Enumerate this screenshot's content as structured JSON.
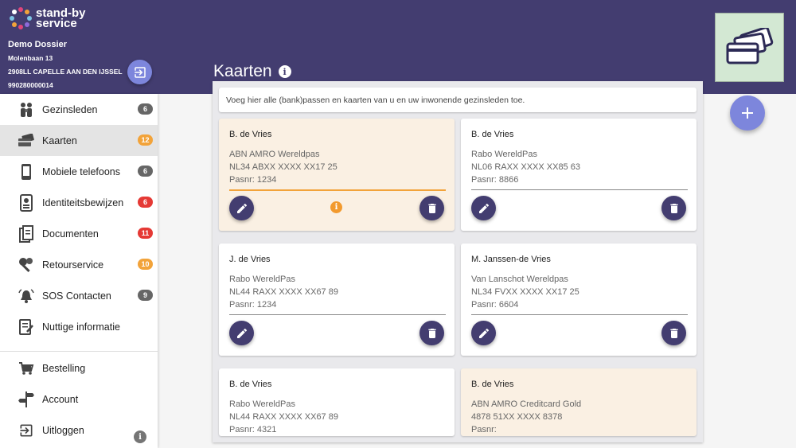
{
  "app": {
    "logo_line1": "stand-by",
    "logo_line2": "service"
  },
  "dossier": {
    "name": "Demo Dossier",
    "street": "Molenbaan 13",
    "city": "2908LL CAPELLE AAN DEN IJSSEL",
    "number": "990280000014"
  },
  "page": {
    "title": "Kaarten",
    "intro": "Voeg hier alle (bank)passen en kaarten van u en uw inwonende gezinsleden toe."
  },
  "sidebar": {
    "items": [
      {
        "label": "Gezinsleden",
        "badge": "6",
        "badge_color": "#666666",
        "icon": "family-icon"
      },
      {
        "label": "Kaarten",
        "badge": "12",
        "badge_color": "#f2a33a",
        "icon": "cards-icon",
        "active": true
      },
      {
        "label": "Mobiele telefoons",
        "badge": "6",
        "badge_color": "#666666",
        "icon": "phone-icon"
      },
      {
        "label": "Identiteitsbewijzen",
        "badge": "6",
        "badge_color": "#e53935",
        "icon": "id-card-icon"
      },
      {
        "label": "Documenten",
        "badge": "11",
        "badge_color": "#e53935",
        "icon": "documents-icon"
      },
      {
        "label": "Retourservice",
        "badge": "10",
        "badge_color": "#f2a33a",
        "icon": "keys-icon"
      },
      {
        "label": "SOS Contacten",
        "badge": "9",
        "badge_color": "#666666",
        "icon": "alarm-bell-icon"
      },
      {
        "label": "Nuttige informatie",
        "badge": "",
        "badge_color": "",
        "icon": "info-document-icon"
      }
    ],
    "bottom": [
      {
        "label": "Bestelling",
        "icon": "cart-icon"
      },
      {
        "label": "Account",
        "icon": "signpost-icon"
      },
      {
        "label": "Uitloggen",
        "icon": "logout-icon"
      }
    ]
  },
  "cards": [
    {
      "owner": "B. de Vries",
      "name": "ABN AMRO Wereldpas",
      "iban": "NL34 ABXX XXXX XX17 25",
      "pasnr": "Pasnr: 1234",
      "warning": true
    },
    {
      "owner": "B. de Vries",
      "name": "Rabo WereldPas",
      "iban": "NL06 RAXX XXXX XX85 63",
      "pasnr": "Pasnr: 8866",
      "warning": false
    },
    {
      "owner": "J. de Vries",
      "name": "Rabo WereldPas",
      "iban": "NL44 RAXX XXXX XX67 89",
      "pasnr": "Pasnr: 1234",
      "warning": false
    },
    {
      "owner": "M. Janssen-de Vries",
      "name": "Van Lanschot Wereldpas",
      "iban": "NL34 FVXX XXXX XX17 25",
      "pasnr": "Pasnr: 6604",
      "warning": false
    },
    {
      "owner": "B. de Vries",
      "name": "Rabo WereldPas",
      "iban": "NL44 RAXX XXXX XX67 89",
      "pasnr": "Pasnr: 4321",
      "warning": false
    },
    {
      "owner": "B. de Vries",
      "name": "ABN AMRO Creditcard Gold",
      "iban": "4878 51XX XXXX 8378",
      "pasnr": "Pasnr:",
      "warning": true
    }
  ],
  "colors": {
    "header": "#433d70",
    "accent": "#7d86dc",
    "warning": "#f2a33a"
  }
}
